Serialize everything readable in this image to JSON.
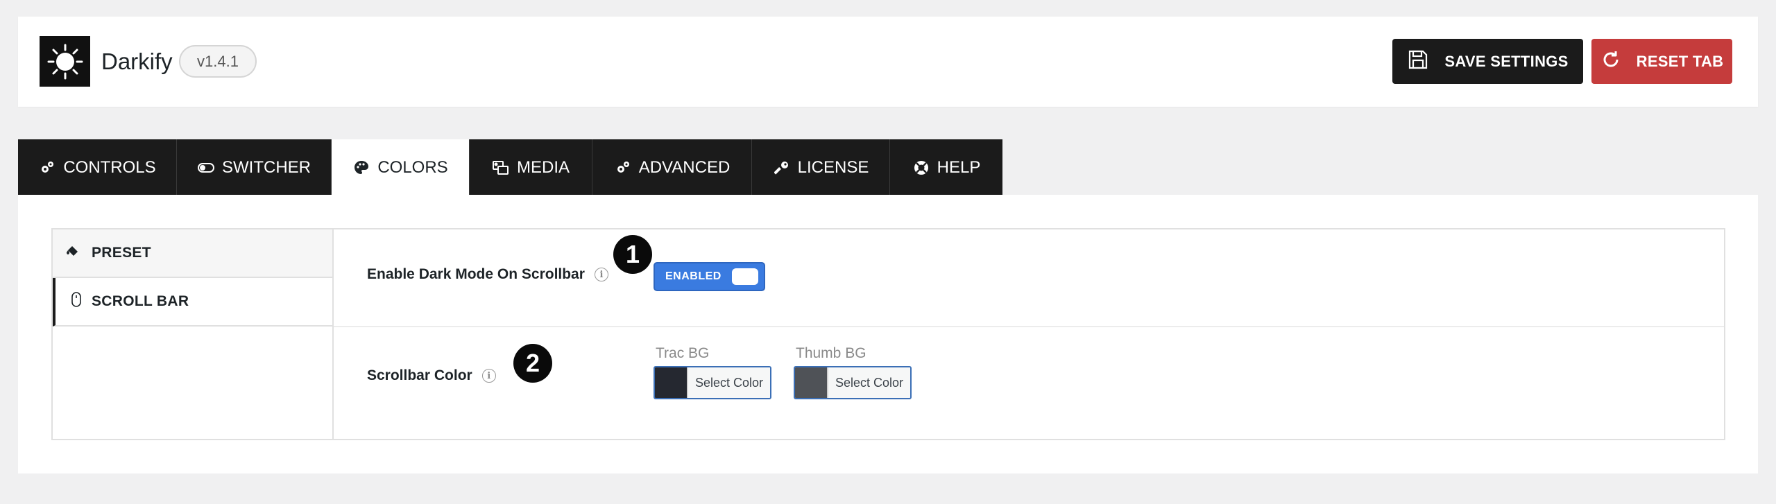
{
  "header": {
    "app_name": "Darkify",
    "version": "v1.4.1",
    "save_label": "SAVE SETTINGS",
    "reset_label": "RESET TAB"
  },
  "tabs": [
    {
      "label": "CONTROLS",
      "icon": "gears-icon"
    },
    {
      "label": "SWITCHER",
      "icon": "toggle-icon"
    },
    {
      "label": "COLORS",
      "icon": "palette-icon",
      "active": true
    },
    {
      "label": "MEDIA",
      "icon": "photo-video-icon"
    },
    {
      "label": "ADVANCED",
      "icon": "gears-icon"
    },
    {
      "label": "LICENSE",
      "icon": "key-icon"
    },
    {
      "label": "HELP",
      "icon": "life-ring-icon"
    }
  ],
  "subnav": {
    "preset": "PRESET",
    "scrollbar": "SCROLL BAR"
  },
  "fields": {
    "dark_scrollbar_label": "Enable Dark Mode On Scrollbar",
    "toggle_state": "ENABLED",
    "scrollbar_color_label": "Scrollbar Color",
    "trac_label": "Trac BG",
    "thumb_label": "Thumb BG",
    "select_color": "Select Color"
  },
  "badges": [
    "1",
    "2"
  ],
  "colors": {
    "trac_bg": "#252830",
    "thumb_bg": "#4f5257",
    "accent": "#3a7be0",
    "reset": "#c53c3c",
    "dark": "#1b1b1b"
  }
}
